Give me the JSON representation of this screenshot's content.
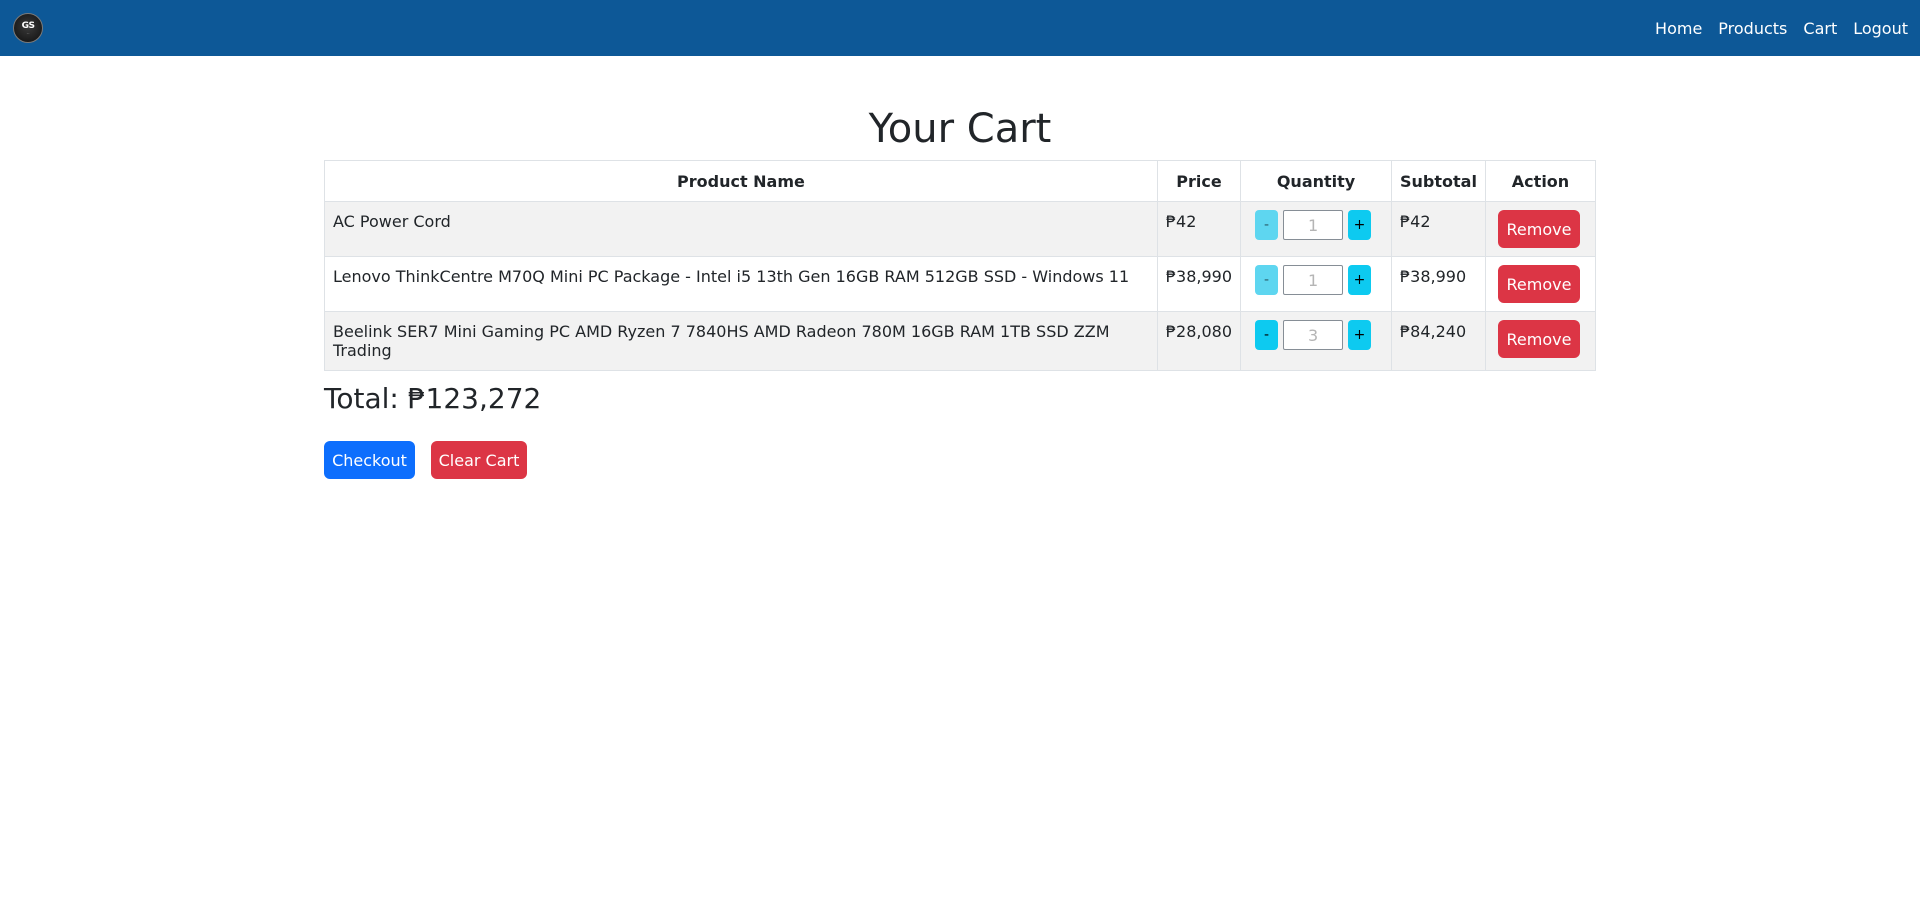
{
  "navbar": {
    "logo_text": "GS",
    "logo_subtext": "...",
    "links": [
      "Home",
      "Products",
      "Cart",
      "Logout"
    ]
  },
  "page": {
    "title": "Your Cart"
  },
  "table": {
    "headers": [
      "Product Name",
      "Price",
      "Quantity",
      "Subtotal",
      "Action"
    ],
    "rows": [
      {
        "name": "AC Power Cord",
        "price": "₱42",
        "quantity": "1",
        "subtotal": "₱42",
        "remove_label": "Remove",
        "decrement_label": "-",
        "increment_label": "+"
      },
      {
        "name": "Lenovo ThinkCentre M70Q Mini PC Package - Intel i5 13th Gen 16GB RAM 512GB SSD - Windows 11",
        "price": "₱38,990",
        "quantity": "1",
        "subtotal": "₱38,990",
        "remove_label": "Remove",
        "decrement_label": "-",
        "increment_label": "+"
      },
      {
        "name": "Beelink SER7 Mini Gaming PC AMD Ryzen 7 7840HS AMD Radeon 780M 16GB RAM 1TB SSD ZZM Trading",
        "price": "₱28,080",
        "quantity": "3",
        "subtotal": "₱84,240",
        "remove_label": "Remove",
        "decrement_label": "-",
        "increment_label": "+"
      }
    ]
  },
  "total_label": "Total: ₱123,272",
  "actions": {
    "checkout_label": "Checkout",
    "clear_label": "Clear Cart"
  },
  "colors": {
    "navbar": "#0d5897",
    "primary": "#0d6efd",
    "danger": "#dc3545",
    "info": "#0dcaf0"
  }
}
